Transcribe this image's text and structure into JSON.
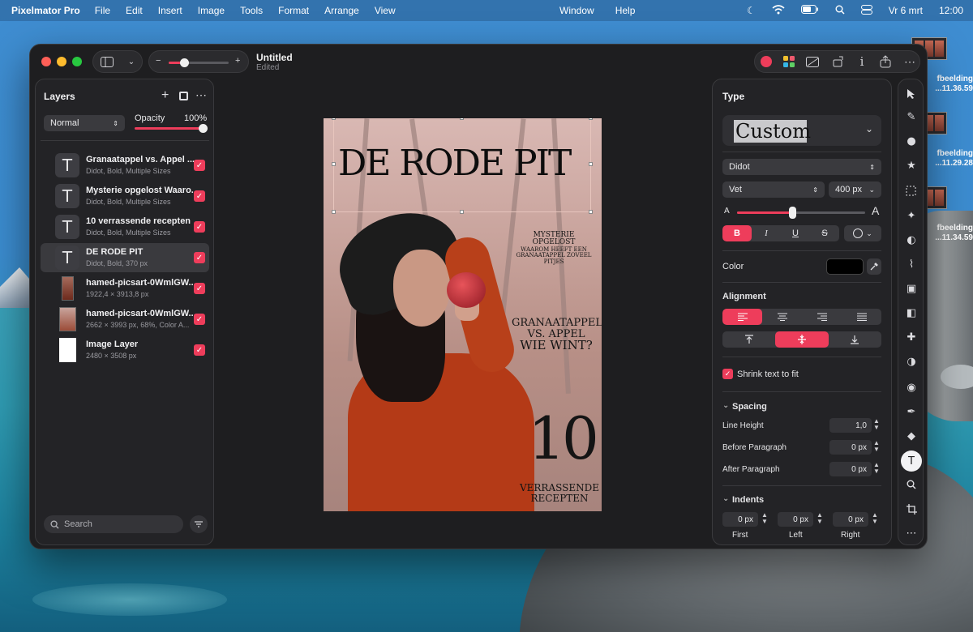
{
  "menubar": {
    "app_name": "Pixelmator Pro",
    "menus": [
      "File",
      "Edit",
      "Insert",
      "Image",
      "Tools",
      "Format",
      "Arrange",
      "View"
    ],
    "center_menus": [
      "Window",
      "Help"
    ],
    "date": "Vr 6 mrt",
    "time": "12:00"
  },
  "desktop": {
    "items": [
      {
        "label_line1": "fbeelding",
        "label_line2": "...11.36.59"
      },
      {
        "label_line1": "fbeelding",
        "label_line2": "...11.29.28"
      },
      {
        "label_line1": "fbeelding",
        "label_line2": "...11.34.59"
      }
    ]
  },
  "window": {
    "doc_title": "Untitled",
    "doc_status": "Edited",
    "zoom_minus": "−",
    "zoom_plus": "+"
  },
  "layers_panel": {
    "title": "Layers",
    "blend_mode": "Normal",
    "opacity_label": "Opacity",
    "opacity_value": "100%",
    "search_placeholder": "Search",
    "layers": [
      {
        "name": "Granaatappel vs. Appel ...",
        "detail": "Didot, Bold, Multiple Sizes",
        "kind": "text"
      },
      {
        "name": "Mysterie opgelost Waaro...",
        "detail": "Didot, Bold, Multiple Sizes",
        "kind": "text"
      },
      {
        "name": "10 verrassende recepten",
        "detail": "Didot, Bold, Multiple Sizes",
        "kind": "text"
      },
      {
        "name": "DE RODE PIT",
        "detail": "Didot, Bold, 370 px",
        "kind": "text"
      },
      {
        "name": "hamed-picsart-0WmlGW...",
        "detail": "1922,4 × 3913,8 px",
        "kind": "image"
      },
      {
        "name": "hamed-picsart-0WmlGW...",
        "detail": "2662 × 3993 px, 68%, Color A...",
        "kind": "image"
      },
      {
        "name": "Image Layer",
        "detail": "2480 × 3508 px",
        "kind": "blank"
      }
    ],
    "text_glyph": "T",
    "check_glyph": "✓"
  },
  "canvas": {
    "title": "DE RODE PIT",
    "mystery": [
      "MYSTERIE OPGELOST",
      "WAAROM HEEFT EEN",
      "GRANAATAPPEL ZOVEEL",
      "PITJES"
    ],
    "versus": [
      "GRANAATAPPEL",
      "VS. APPEL"
    ],
    "winner": "WIE WINT?",
    "number": "10",
    "recipes": [
      "VERRASSENDE",
      "RECEPTEN"
    ]
  },
  "type_panel": {
    "title": "Type",
    "style_preset": "Custom",
    "font_family": "Didot",
    "font_weight": "Vet",
    "font_size": "400 px",
    "size_small_label": "A",
    "size_large_label": "A",
    "size_slider_value": 0.43,
    "style_buttons": [
      "B",
      "I",
      "U",
      "S"
    ],
    "color_label": "Color",
    "color_value": "#000000",
    "alignment_label": "Alignment",
    "shrink_label": "Shrink text to fit",
    "spacing_label": "Spacing",
    "line_height_label": "Line Height",
    "line_height_value": "1,0",
    "before_paragraph_label": "Before Paragraph",
    "before_paragraph_value": "0 px",
    "after_paragraph_label": "After Paragraph",
    "after_paragraph_value": "0 px",
    "indents_label": "Indents",
    "indent_values": [
      "0 px",
      "0 px",
      "0 px"
    ],
    "indent_labels": [
      "First",
      "Left",
      "Right"
    ]
  },
  "colors": {
    "accent": "#ee3d5b",
    "window_bg": "#1e1e20",
    "panel_bg": "#232326"
  },
  "tools": [
    "arrow-select-icon",
    "paint-icon",
    "shape-effects-icon",
    "star-icon",
    "marquee-select-icon",
    "magic-select-icon",
    "color-adjust-icon",
    "brush-icon",
    "fill-icon",
    "eraser-icon",
    "retouch-icon",
    "distort-icon",
    "blur-icon",
    "pen-icon",
    "shapes-icon",
    "type-icon",
    "zoom-icon",
    "crop-icon",
    "more-tools-icon"
  ]
}
